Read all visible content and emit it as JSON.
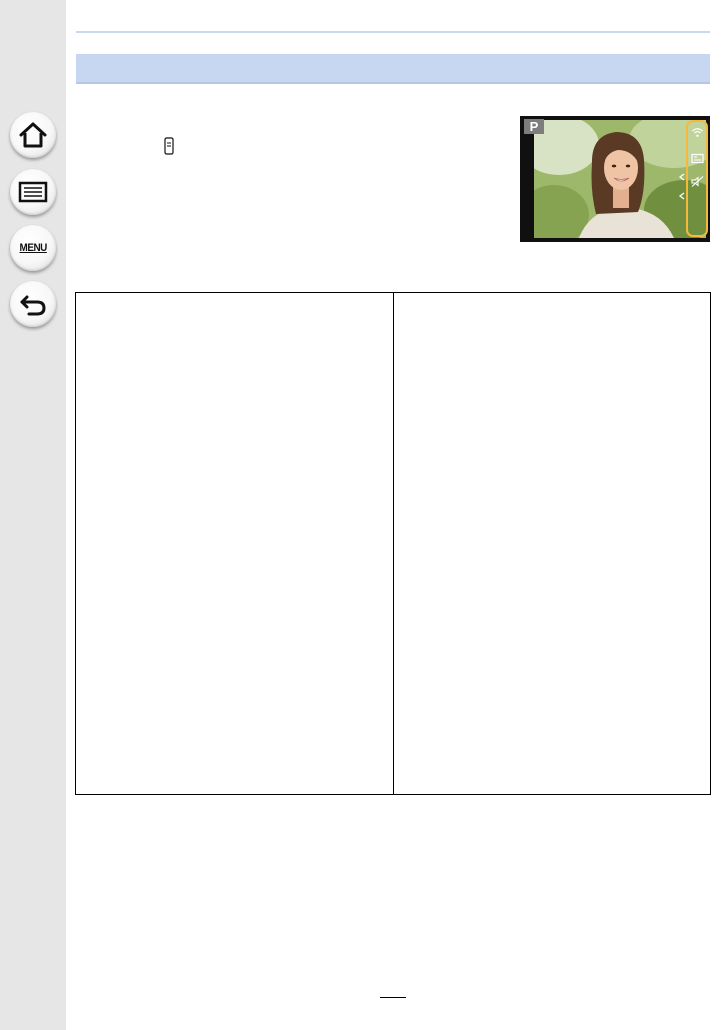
{
  "sidebar": {
    "buttons": [
      {
        "name": "home-button",
        "icon": "home-icon"
      },
      {
        "name": "contents-button",
        "icon": "list-icon"
      },
      {
        "name": "menu-button",
        "icon": "menu-icon",
        "label": "MENU"
      },
      {
        "name": "back-button",
        "icon": "back-arrow-icon"
      }
    ]
  },
  "preview": {
    "mode": "P",
    "tab_icons": [
      "wifi-icon",
      "display-icon",
      "mute-icon"
    ],
    "accent": "#f5b93e"
  }
}
